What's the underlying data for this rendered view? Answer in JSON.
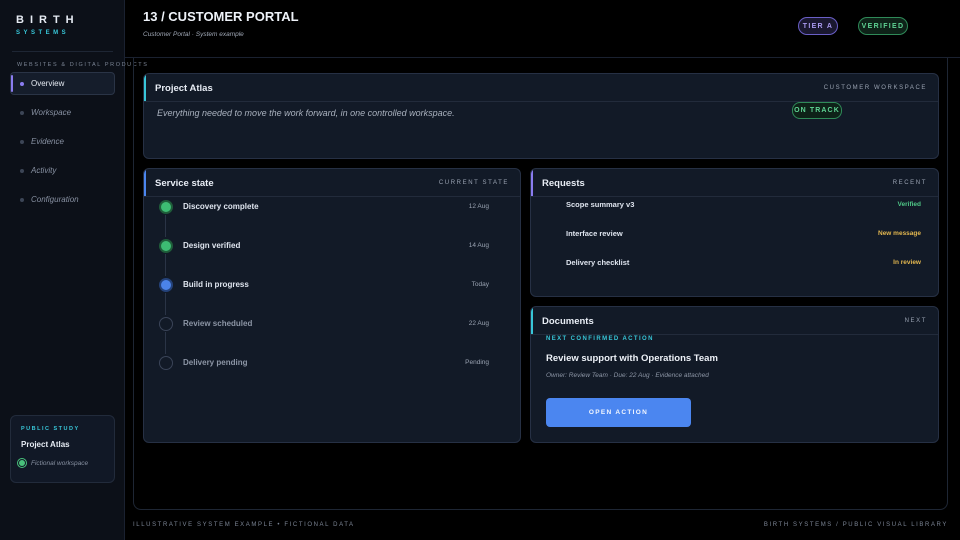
{
  "brand": {
    "name": "BIRTH",
    "sub": "SYSTEMS"
  },
  "sidebar": {
    "section_label": "WEBSITES & DIGITAL PRODUCTS",
    "items": [
      {
        "label": "Overview",
        "active": true
      },
      {
        "label": "Workspace",
        "active": false
      },
      {
        "label": "Evidence",
        "active": false
      },
      {
        "label": "Activity",
        "active": false
      },
      {
        "label": "Configuration",
        "active": false
      }
    ],
    "study": {
      "label": "PUBLIC STUDY",
      "title": "Project Atlas",
      "note": "Fictional workspace"
    }
  },
  "header": {
    "title": "13 / CUSTOMER PORTAL",
    "subtitle": "Customer Portal · System example",
    "badges": {
      "tier": "TIER A",
      "verified": "VERIFIED"
    }
  },
  "project": {
    "title": "Project Atlas",
    "tag": "CUSTOMER WORKSPACE",
    "description": "Everything needed to move the work forward, in one controlled workspace.",
    "status": "ON TRACK"
  },
  "service": {
    "title": "Service state",
    "tag": "CURRENT STATE",
    "steps": [
      {
        "label": "Discovery complete",
        "date": "12 Aug",
        "state": "done"
      },
      {
        "label": "Design verified",
        "date": "14 Aug",
        "state": "done"
      },
      {
        "label": "Build in progress",
        "date": "Today",
        "state": "progress"
      },
      {
        "label": "Review scheduled",
        "date": "22 Aug",
        "state": "pending"
      },
      {
        "label": "Delivery pending",
        "date": "Pending",
        "state": "pending"
      }
    ]
  },
  "requests": {
    "title": "Requests",
    "tag": "RECENT",
    "items": [
      {
        "name": "Scope summary v3",
        "status": "Verified",
        "color": "#4fc887"
      },
      {
        "name": "Interface review",
        "status": "New message",
        "color": "#e3b74f"
      },
      {
        "name": "Delivery checklist",
        "status": "In review",
        "color": "#e3b74f"
      }
    ]
  },
  "documents": {
    "title": "Documents",
    "tag": "NEXT",
    "next_label": "NEXT CONFIRMED ACTION",
    "action_title": "Review support with Operations Team",
    "meta": "Owner: Review Team  ·  Due: 22 Aug  ·  Evidence attached",
    "button": "OPEN ACTION"
  },
  "footer": {
    "left": "ILLUSTRATIVE SYSTEM EXAMPLE  •  FICTIONAL DATA",
    "right": "BIRTH SYSTEMS / PUBLIC VISUAL LIBRARY"
  },
  "colors": {
    "accent_purple": "#8a7cf0",
    "accent_cyan": "#38c6d8",
    "accent_blue": "#4b86f0",
    "success": "#3dbd73"
  }
}
